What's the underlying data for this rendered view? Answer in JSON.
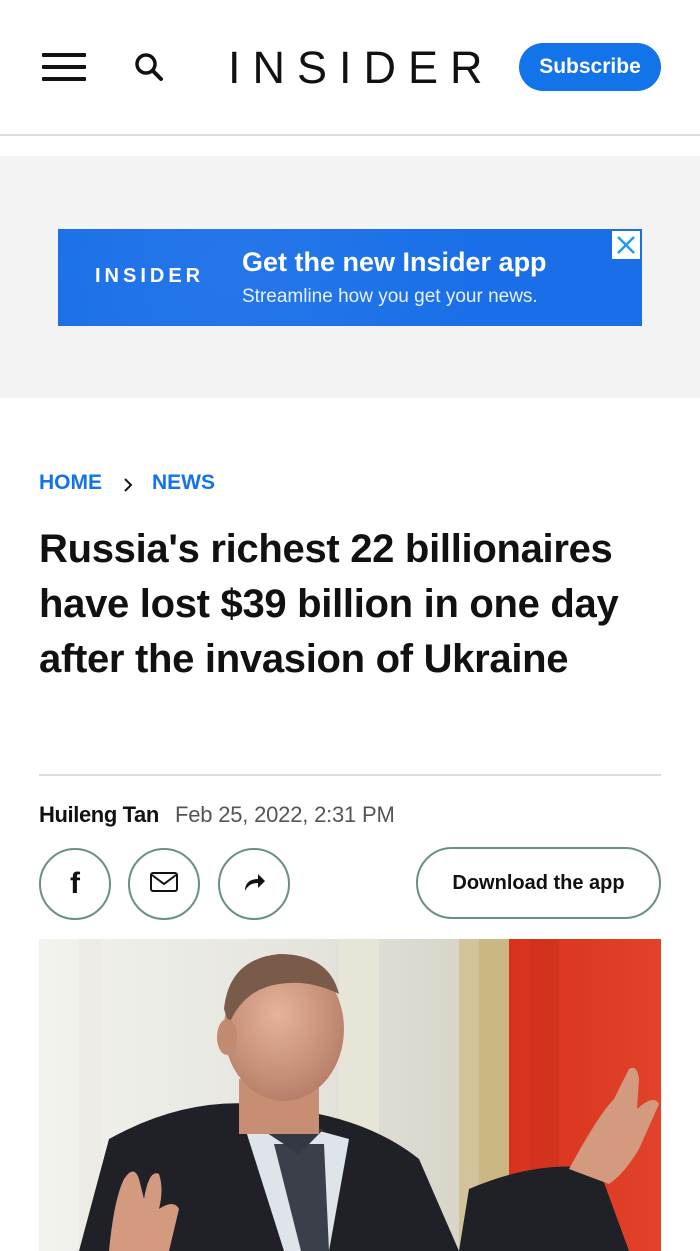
{
  "header": {
    "logo": "INSIDER",
    "subscribe_label": "Subscribe",
    "menu_icon": "hamburger-menu-icon",
    "search_icon": "search-icon"
  },
  "ad": {
    "logo": "INSIDER",
    "title": "Get the new Insider app",
    "subtitle": "Streamline how you get your news.",
    "close_icon": "close-icon",
    "color": "#1a6fe8"
  },
  "breadcrumb": {
    "items": [
      "HOME",
      "NEWS"
    ],
    "separator_icon": "chevron-right-icon"
  },
  "article": {
    "headline": "Russia's richest 22 billionaires have lost $39 billion in one day after the invasion of Ukraine",
    "author": "Huileng Tan",
    "date": "Feb 25, 2022, 2:31 PM"
  },
  "share": {
    "facebook_icon": "facebook-icon",
    "facebook_glyph": "f",
    "email_icon": "email-icon",
    "share_icon": "share-arrow-icon",
    "download_label": "Download the app"
  },
  "colors": {
    "accent": "#1373e8",
    "button_border": "#6b8e8a"
  }
}
